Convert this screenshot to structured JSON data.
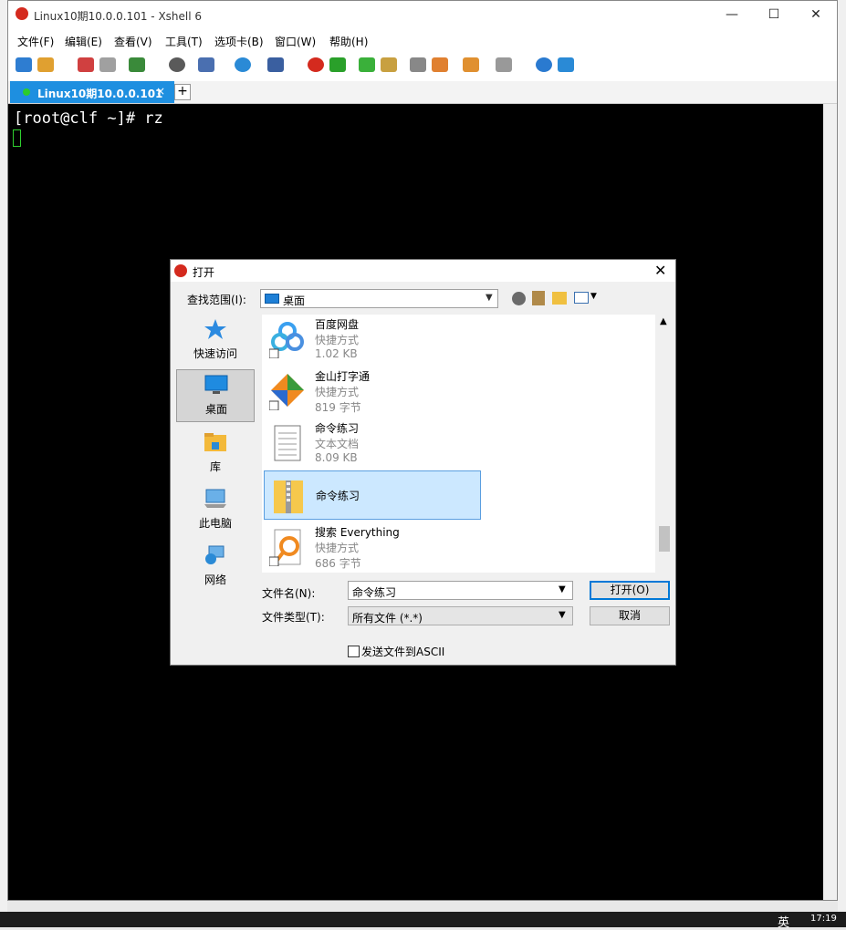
{
  "window": {
    "title": "Linux10期10.0.0.101 - Xshell 6",
    "minimize": "—",
    "maximize": "☐",
    "close": "✕"
  },
  "menu": [
    "文件(F)",
    "编辑(E)",
    "查看(V)",
    "工具(T)",
    "选项卡(B)",
    "窗口(W)",
    "帮助(H)"
  ],
  "tabs": {
    "active_label": "Linux10期10.0.0.101",
    "close": "×",
    "add": "+"
  },
  "terminal": {
    "line1": "[root@clf ~]# rz"
  },
  "taskbar": {
    "time": "17:19",
    "ime": "英"
  },
  "dialog": {
    "title": "打开",
    "close": "✕",
    "look_in_label": "查找范围(I):",
    "look_in_value": "桌面",
    "places": [
      {
        "label": "快速访问",
        "icon": "star-icon"
      },
      {
        "label": "桌面",
        "icon": "desktop-icon"
      },
      {
        "label": "库",
        "icon": "library-icon"
      },
      {
        "label": "此电脑",
        "icon": "computer-icon"
      },
      {
        "label": "网络",
        "icon": "network-icon"
      }
    ],
    "files": [
      {
        "name": "百度网盘",
        "type": "快捷方式",
        "size": "1.02 KB",
        "icon": "baidu-netdisk-icon"
      },
      {
        "name": "金山打字通",
        "type": "快捷方式",
        "size": "819 字节",
        "icon": "typing-app-icon"
      },
      {
        "name": "命令练习",
        "type": "文本文档",
        "size": "8.09 KB",
        "icon": "text-document-icon"
      },
      {
        "name": "命令练习",
        "type": "",
        "size": "",
        "icon": "zip-folder-icon",
        "selected": true
      },
      {
        "name": "搜索 Everything",
        "type": "快捷方式",
        "size": "686 字节",
        "icon": "everything-search-icon"
      }
    ],
    "filename_label": "文件名(N):",
    "filename_value": "命令练习",
    "filetype_label": "文件类型(T):",
    "filetype_value": "所有文件 (*.*)",
    "open_button": "打开(O)",
    "cancel_button": "取消",
    "ascii_label": "发送文件到ASCII"
  }
}
